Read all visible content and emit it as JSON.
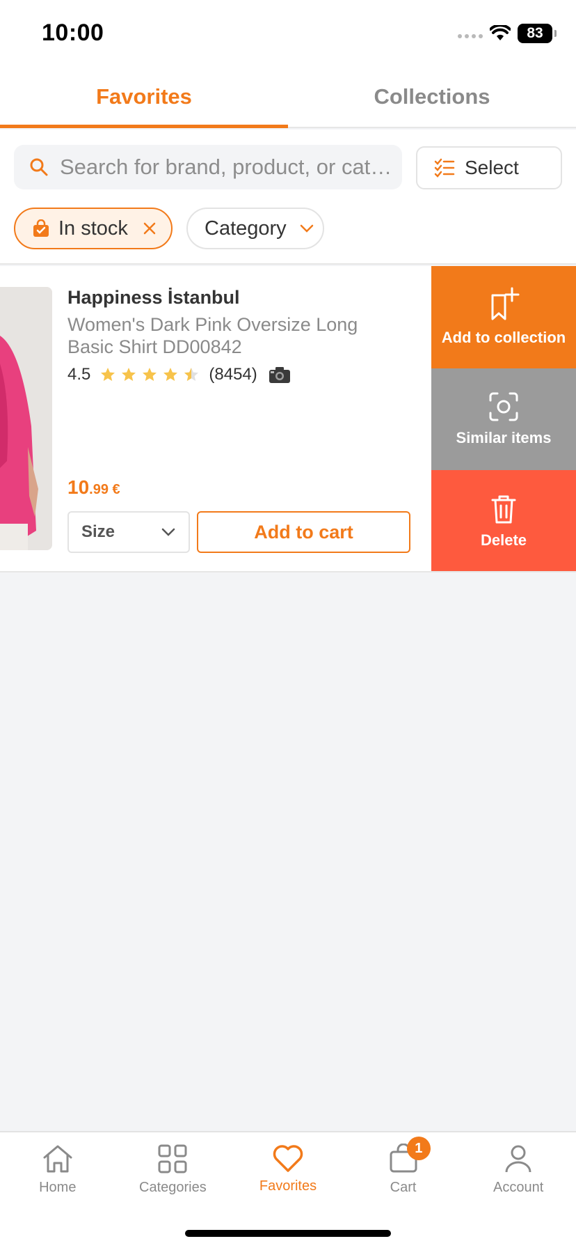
{
  "status_bar": {
    "time": "10:00",
    "battery": "83"
  },
  "tabs": [
    {
      "label": "Favorites",
      "active": true
    },
    {
      "label": "Collections",
      "active": false
    }
  ],
  "search": {
    "placeholder": "Search for brand, product, or category"
  },
  "select_button": {
    "label": "Select"
  },
  "filters": {
    "in_stock": "In stock",
    "category": "Category"
  },
  "product": {
    "brand": "Happiness İstanbul",
    "name": "Women's Dark Pink Oversize Long Basic Shirt DD00842",
    "rating": "4.5",
    "rating_value": 4.5,
    "review_count": "(8454)",
    "price_int": "10",
    "price_dec": ".99 €",
    "size_label": "Size",
    "add_to_cart": "Add to cart"
  },
  "swipe_actions": {
    "add_to_collection": "Add to collection",
    "similar_items": "Similar items",
    "delete": "Delete"
  },
  "bottom_nav": {
    "home": "Home",
    "categories": "Categories",
    "favorites": "Favorites",
    "cart": "Cart",
    "cart_badge": "1",
    "account": "Account"
  },
  "colors": {
    "accent": "#f27a1a",
    "delete": "#fe5a3e",
    "similar": "#9b9b9b",
    "star": "#f7c34b"
  }
}
